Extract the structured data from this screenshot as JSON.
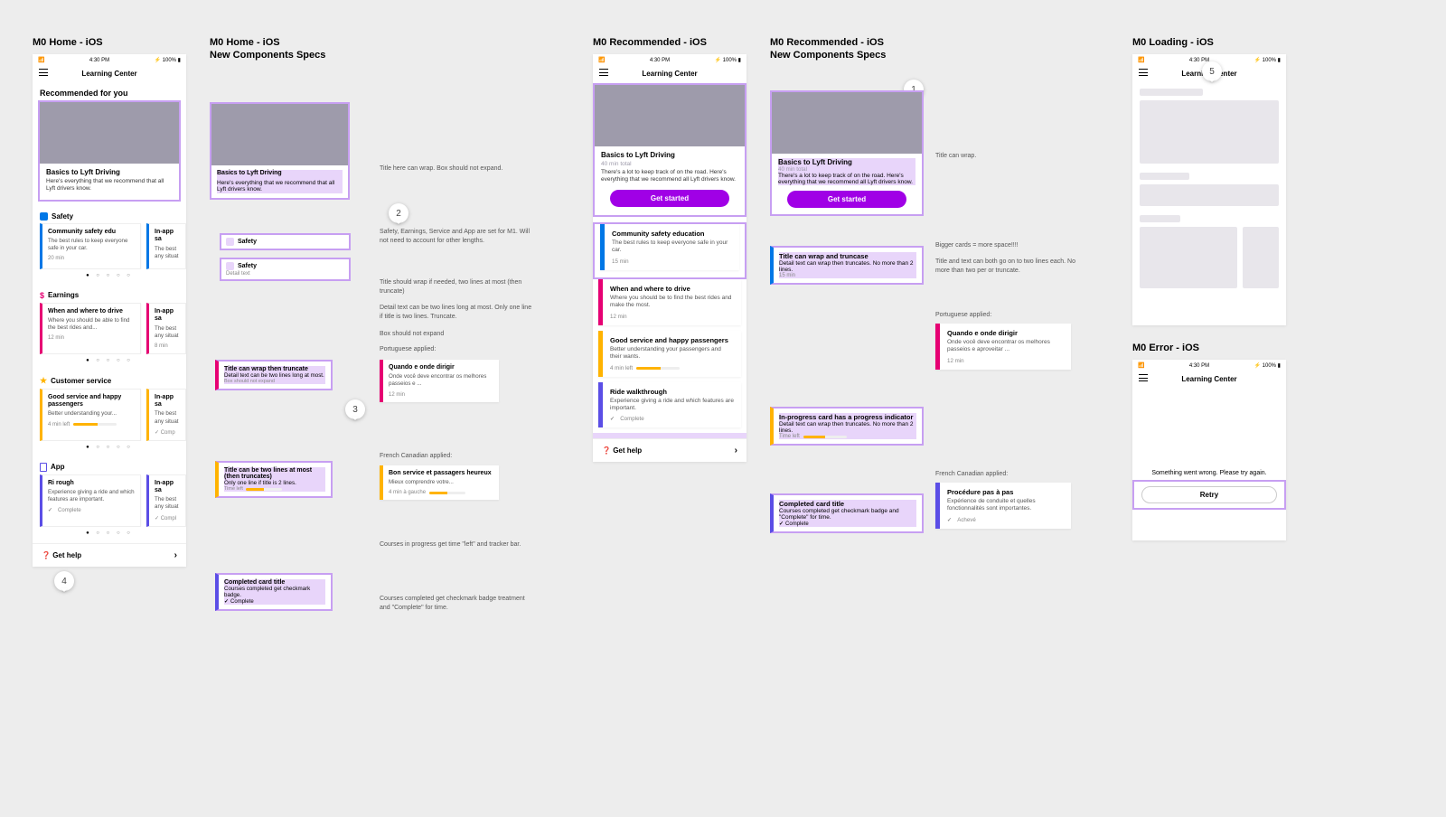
{
  "status": {
    "left": "📶  ",
    "time": "4:30 PM",
    "right": "⚡ 100% ▮"
  },
  "titles": {
    "home": "M0 Home - iOS",
    "home_specs_l1": "M0 Home - iOS",
    "home_specs_l2": "New Components Specs",
    "rec": "M0 Recommended - iOS",
    "rec_specs_l1": "M0 Recommended - iOS",
    "rec_specs_l2": "New Components Specs",
    "loading": "M0 Loading - iOS",
    "error": "M0 Error - iOS"
  },
  "app_title": "Learning Center",
  "recommended_header": "Recommended for you",
  "hero": {
    "title": "Basics to Lyft Driving",
    "sub": "40 min total",
    "detail_home": "Here's everything that we recommend that all Lyft drivers know.",
    "detail_rec": "There's a lot to keep track of on the road. Here's everything that we recommend all Lyft drivers know.",
    "cta": "Get started"
  },
  "cats": {
    "safety": "Safety",
    "earnings": "Earnings",
    "customer": "Customer service",
    "app": "App"
  },
  "home_cards": {
    "safety": {
      "t": "Community safety edu",
      "d": "The best rules to keep everyone safe in your car.",
      "m": "20 min"
    },
    "safety_peek": {
      "t": "In-app sa",
      "d": "The best\nany situat",
      "m": ""
    },
    "earn": {
      "t": "When and where to drive",
      "d": "Where you should be able to find the best rides and...",
      "m": "12 min"
    },
    "earn_peek": {
      "t": "In-app sa",
      "d": "The best\nany situat",
      "m": "8 min"
    },
    "cust": {
      "t": "Good service and happy passengers",
      "d": "Better understanding your...",
      "m": "4 min left"
    },
    "cust_peek": {
      "t": "In-app sa",
      "d": "The best\nany situat",
      "m": "✓ Comp"
    },
    "app": {
      "t": "Ri            rough",
      "d": "Experience giving a ride and which features are important.",
      "m": "Complete"
    },
    "app_peek": {
      "t": "In-app sa",
      "d": "The best\nany situat",
      "m": "✓ Compl"
    }
  },
  "get_help": "Get help",
  "specs": {
    "safety_detail": "Detail text",
    "title_wrap_note": "Title here can wrap.\nBox should not expand.",
    "m1_note": "Safety, Earnings, Service and App are set for M1. Will not need to account for other lengths.",
    "card_title_note": "Title should wrap if needed, two lines at most (then truncate)",
    "card_detail_note": "Detail text can be two lines long at most. Only one line if title is two lines. Truncate.",
    "box_note": "Box should not expand",
    "pt_label": "Portuguese applied:",
    "fr_label": "French Canadian applied:",
    "progress_note": "Courses in progress get time \"left\" and tracker bar.",
    "complete_note": "Courses completed get checkmark badge treatment and \"Complete\" for time.",
    "small1": {
      "t": "Title can wrap then truncate",
      "d": "Detail text can be two lines long at most.",
      "m": "Box should not expand"
    },
    "small2": {
      "t": "Title can be two lines at most (then truncates)",
      "d": "Only one line if title is 2 lines.",
      "m": "Time left"
    },
    "pt": {
      "t": "Quando e onde dirigir",
      "d": "Onde você deve encontrar os melhores passeios e ...",
      "m": "12 min"
    },
    "fr": {
      "t": "Bon service et passagers heureux",
      "d": "Mieux comprendre votre...",
      "m": "4 min à gauche"
    },
    "completed": {
      "t": "Completed card title",
      "d": "Courses completed get checkmark badge.",
      "m": "Complete"
    }
  },
  "rec_list": {
    "a": {
      "t": "Community safety education",
      "d": "The best rules to keep everyone safe in your car.",
      "m": "15 min"
    },
    "b": {
      "t": "When and where to drive",
      "d": "Where you should be to find the best rides and make the most.",
      "m": "12 min"
    },
    "c": {
      "t": "Good service and happy passengers",
      "d": "Better understanding your passengers and their wants.",
      "m": "4 min left"
    },
    "d": {
      "t": "Ride walkthrough",
      "d": "Experience giving a ride and which features are important.",
      "m": "Complete"
    }
  },
  "rec_specs": {
    "title_wrap": "Title can wrap.",
    "bigger": "Bigger cards = more space!!!!",
    "two_line": "Title and text can both go on to two lines each. No more than two per or truncate.",
    "a": {
      "t": "Title can wrap and truncase",
      "d": "Detail text can wrap then truncates. No more than 2 lines.",
      "m": "15 min"
    },
    "b": {
      "t": "In-progress card has a progress indicator",
      "d": "Detail text can wrap then truncates. No more than 2 lines.",
      "m": "Time left"
    },
    "c": {
      "t": "Completed card title",
      "d": "Courses completed get checkmark badge and \"Complete\" for time.",
      "m": "Complete"
    },
    "pt": {
      "t": "Quando e onde dirigir",
      "d": "Onde você deve encontrar os melhores passeios e aproveitar ...",
      "m": "12 min"
    },
    "fr": {
      "t": "Procédure pas à pas",
      "d": "Expérience de conduite et quelles fonctionnalités sont importantes.",
      "m": "Achevé"
    }
  },
  "error": {
    "msg": "Something went wrong. Please try again.",
    "btn": "Retry"
  },
  "badges": {
    "b1": "1",
    "b2": "2",
    "b3": "3",
    "b4": "4",
    "b5": "5"
  }
}
